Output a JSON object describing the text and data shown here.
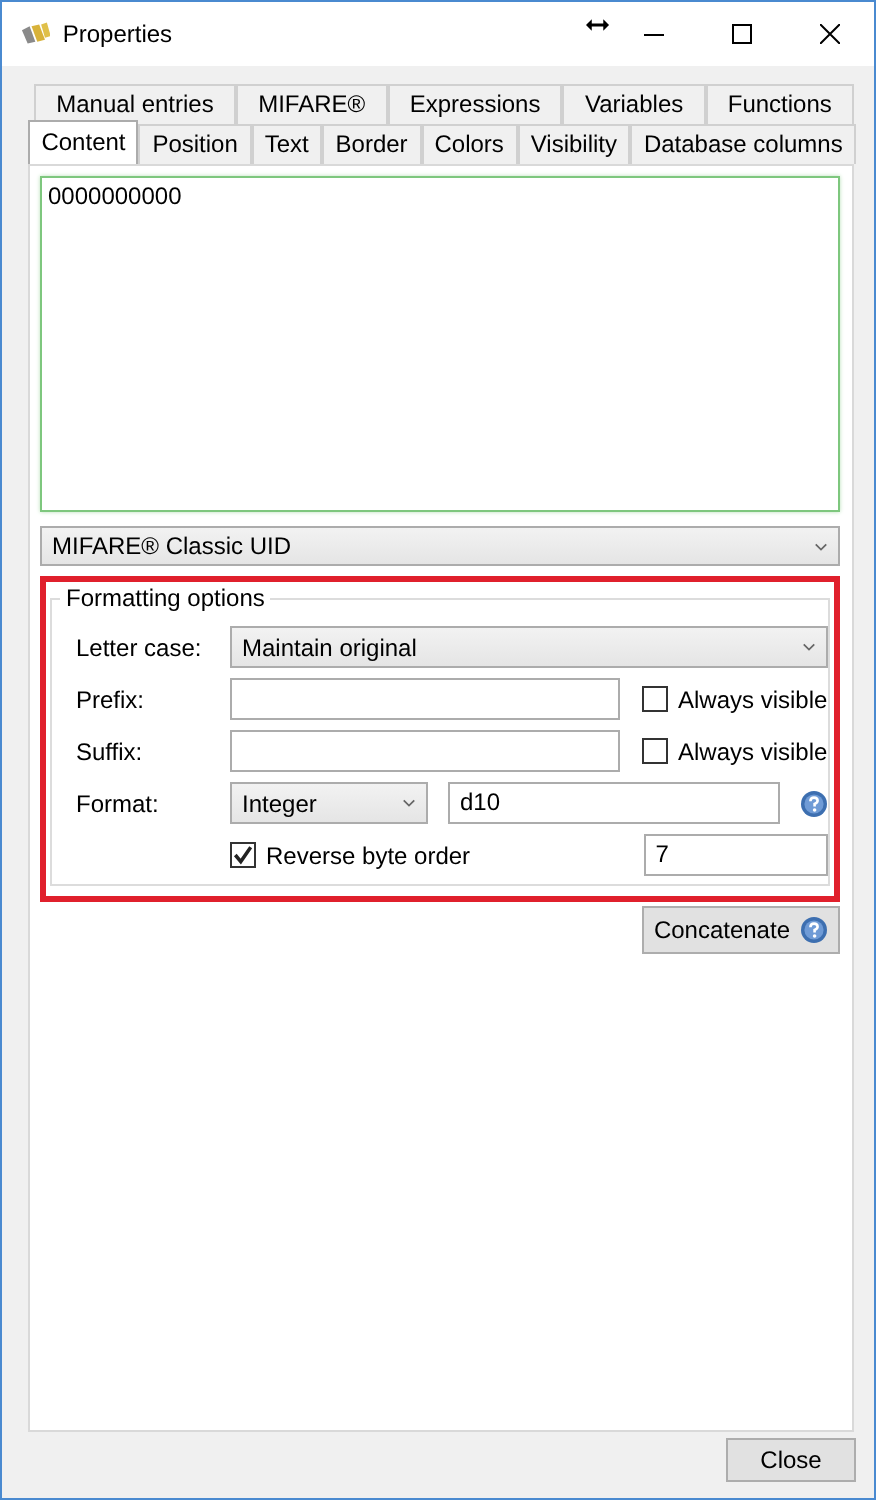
{
  "window": {
    "title": "Properties"
  },
  "tab_rows": [
    [
      {
        "label": "Manual entries",
        "selected": false
      },
      {
        "label": "MIFARE®",
        "selected": false
      },
      {
        "label": "Expressions",
        "selected": false
      },
      {
        "label": "Variables",
        "selected": false
      },
      {
        "label": "Functions",
        "selected": false
      }
    ],
    [
      {
        "label": "Content",
        "selected": true
      },
      {
        "label": "Position",
        "selected": false
      },
      {
        "label": "Text",
        "selected": false
      },
      {
        "label": "Border",
        "selected": false
      },
      {
        "label": "Colors",
        "selected": false
      },
      {
        "label": "Visibility",
        "selected": false
      },
      {
        "label": "Database columns",
        "selected": false
      }
    ]
  ],
  "content_text": "0000000000",
  "source": {
    "value": "MIFARE® Classic UID"
  },
  "formatting": {
    "title": "Formatting options",
    "letter_case": {
      "label": "Letter case:",
      "value": "Maintain original"
    },
    "prefix": {
      "label": "Prefix:",
      "always_visible": {
        "label": "Always visible",
        "checked": false
      }
    },
    "suffix": {
      "label": "Suffix:",
      "always_visible": {
        "label": "Always visible",
        "checked": false
      }
    },
    "format": {
      "label": "Format:",
      "type": "Integer",
      "pattern": "d10"
    },
    "reverse_byte_order": {
      "label": "Reverse byte order",
      "checked": true,
      "value": "7"
    }
  },
  "concatenate_button": "Concatenate",
  "close_button": "Close"
}
